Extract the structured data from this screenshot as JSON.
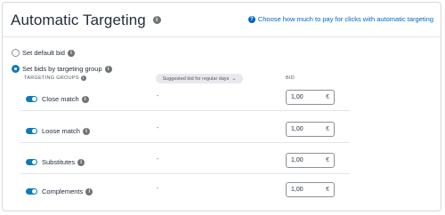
{
  "header": {
    "title": "Automatic Targeting",
    "help_link": "Choose how much to pay for clicks with automatic targeting"
  },
  "options": {
    "default_bid_label": "Set default bid",
    "targeting_group_label": "Set bids by targeting group"
  },
  "table": {
    "col_targeting_groups": "TARGETING GROUPS",
    "col_suggested": "Suggested bid for regular days",
    "col_bid": "BID",
    "rows": [
      {
        "label": "Close match",
        "suggested": "-",
        "bid": "1,00",
        "currency": "€",
        "enabled": true
      },
      {
        "label": "Loose match",
        "suggested": "-",
        "bid": "1,00",
        "currency": "€",
        "enabled": true
      },
      {
        "label": "Substitutes",
        "suggested": "-",
        "bid": "1,00",
        "currency": "€",
        "enabled": true
      },
      {
        "label": "Complements",
        "suggested": "-",
        "bid": "1,00",
        "currency": "€",
        "enabled": true
      }
    ]
  },
  "colors": {
    "accent": "#0a7bba",
    "link": "#0066c0"
  }
}
